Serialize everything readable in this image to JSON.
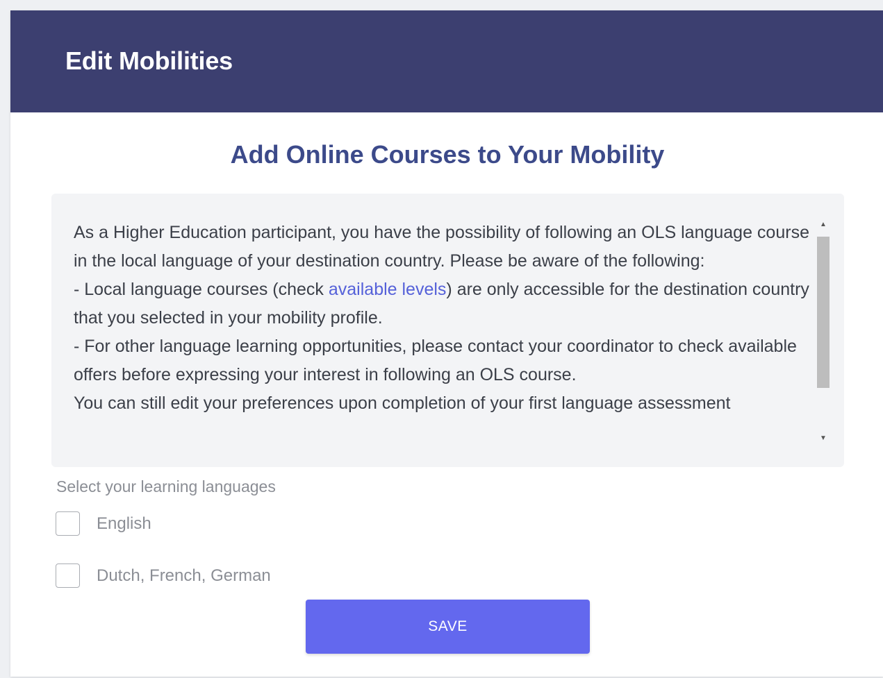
{
  "header": {
    "title": "Edit Mobilities"
  },
  "section": {
    "title": "Add Online Courses to Your Mobility"
  },
  "info": {
    "para1": "As a Higher Education participant, you have the possibility of following an OLS language course in the local language of your destination country. Please be aware of the following:",
    "para2_prefix": "- Local language courses (check ",
    "para2_link": "available levels",
    "para2_suffix": ") are only accessible for the destination country that you selected in your mobility profile.",
    "para3": "- For other language learning opportunities, please contact your coordinator to check available offers before expressing your interest in following an OLS course.",
    "para4": "You can still edit your preferences upon completion of your first language assessment"
  },
  "languages": {
    "label": "Select your learning languages",
    "options": [
      {
        "label": "English",
        "checked": false
      },
      {
        "label": "Dutch, French, German",
        "checked": false
      }
    ]
  },
  "actions": {
    "save_label": "SAVE"
  },
  "colors": {
    "header_bg": "#3c3f70",
    "title": "#3c4a8a",
    "link": "#5561d9",
    "save_button": "#6368ee"
  }
}
